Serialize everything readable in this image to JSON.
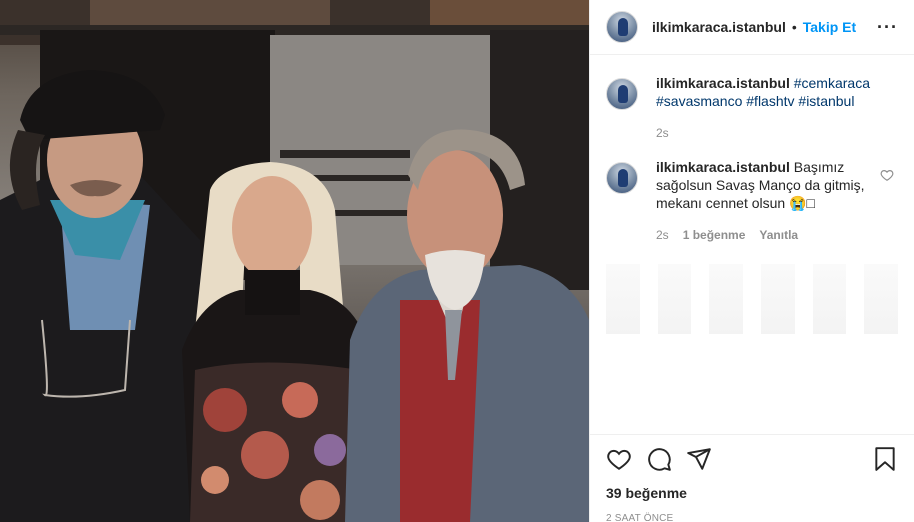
{
  "post": {
    "username": "ilkimkaraca.istanbul",
    "separator": "•",
    "follow_label": "Takip Et",
    "more_label": "···",
    "photo_alt": "Üç kişi yan yana poz veriyor"
  },
  "comments": [
    {
      "username": "ilkimkaraca.istanbul",
      "hashtags": "#cemkaraca #savasmanco #flashtv #istanbul",
      "age": "2s"
    },
    {
      "username": "ilkimkaraca.istanbul",
      "text": "Başımız sağolsun Savaş Manço da gitmiş, mekanı cennet olsun 😭□",
      "age": "2s",
      "likes": "1 beğenme",
      "reply_label": "Yanıtla"
    }
  ],
  "footer": {
    "likes_label": "39 beğenme",
    "timestamp": "2 SAAT ÖNCE"
  },
  "icons": [
    "heart-icon",
    "comment-icon",
    "share-icon",
    "bookmark-icon",
    "more-options-icon"
  ]
}
